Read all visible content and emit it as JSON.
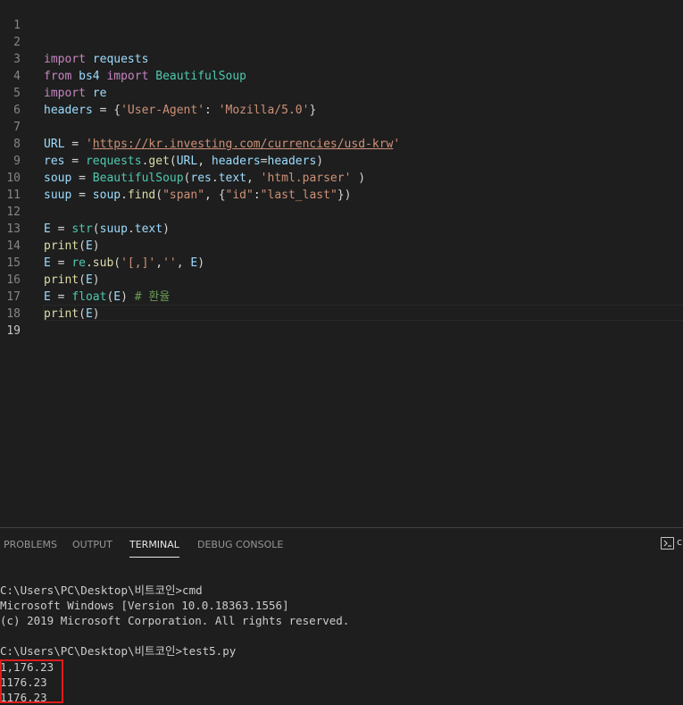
{
  "editor": {
    "line_numbers": [
      "1",
      "2",
      "3",
      "4",
      "5",
      "6",
      "7",
      "8",
      "9",
      "10",
      "11",
      "12",
      "13",
      "14",
      "15",
      "16",
      "17",
      "18",
      "19"
    ],
    "line2": {
      "kw_from": "from",
      "mod": "bs4",
      "kw_import": "import",
      "cls": "BeautifulSoup"
    },
    "line3": {
      "kw_import": "import",
      "mod": "re"
    },
    "line4": {
      "kw_import": "import",
      "mod": "requests"
    },
    "line5": {
      "var": "headers",
      "op": " = {",
      "key": "'User-Agent'",
      "colon": ": ",
      "val": "'Mozilla/5.0'",
      "close": "}"
    },
    "line7": {
      "var": "URL",
      "op": " = ",
      "q1": "'",
      "url": "https://kr.investing.com/currencies/usd-krw",
      "q2": "'"
    },
    "line8": {
      "var": "res",
      "op": " = ",
      "obj": "requests",
      "dot": ".",
      "fn": "get",
      "p1": "(",
      "a1": "URL",
      "c1": ", ",
      "a2": "headers",
      "eq": "=",
      "a3": "headers",
      "p2": ")"
    },
    "line9": {
      "var": "soup",
      "op": " = ",
      "cls": "BeautifulSoup",
      "p1": "(",
      "a1": "res",
      "dot": ".",
      "a2": "text",
      "c1": ", ",
      "str": "'html.parser'",
      "p2": " )"
    },
    "line10": {
      "var": "suup",
      "op": " = ",
      "obj": "soup",
      "dot": ".",
      "fn": "find",
      "p1": "(",
      "s1": "\"span\"",
      "c1": ", {",
      "s2": "\"id\"",
      "colon": ":",
      "s3": "\"last_last\"",
      "p2": "})"
    },
    "line12": {
      "var": "E",
      "op": " = ",
      "fn": "str",
      "p1": "(",
      "a1": "suup",
      "dot": ".",
      "a2": "text",
      "p2": ")"
    },
    "line13": {
      "fn": "print",
      "p1": "(",
      "a1": "E",
      "p2": ")"
    },
    "line14": {
      "var": "E",
      "op": " = ",
      "obj": "re",
      "dot": ".",
      "fn": "sub",
      "p1": "(",
      "s1": "'[,]'",
      "c1": ",",
      "s2": "''",
      "c2": ", ",
      "a1": "E",
      "p2": ")"
    },
    "line15": {
      "fn": "print",
      "p1": "(",
      "a1": "E",
      "p2": ")"
    },
    "line16": {
      "var": "E",
      "op": " = ",
      "fn": "float",
      "p1": "(",
      "a1": "E",
      "p2": ")",
      "comment": " # 환율"
    },
    "line17": {
      "fn": "print",
      "p1": "(",
      "a1": "E",
      "p2": ")"
    }
  },
  "panel": {
    "tabs": [
      "PROBLEMS",
      "OUTPUT",
      "TERMINAL",
      "DEBUG CONSOLE"
    ],
    "active_tab": "TERMINAL",
    "terminal_icon": "terminal-icon",
    "terminal_label_truncated": "c",
    "terminal_lines": [
      "C:\\Users\\PC\\Desktop\\비트코인>cmd",
      "Microsoft Windows [Version 10.0.18363.1556]",
      "(c) 2019 Microsoft Corporation. All rights reserved.",
      "C:\\Users\\PC\\Desktop\\비트코인>test5.py",
      "1,176.23",
      "1176.23",
      "1176.23"
    ]
  },
  "colors": {
    "background": "#1e1e1e",
    "keyword": "#c586c0",
    "variable": "#9cdcfe",
    "class": "#4ec9b0",
    "function": "#dcdcaa",
    "string": "#ce9178",
    "comment": "#6a9955",
    "highlight_box": "#e01b1b"
  }
}
